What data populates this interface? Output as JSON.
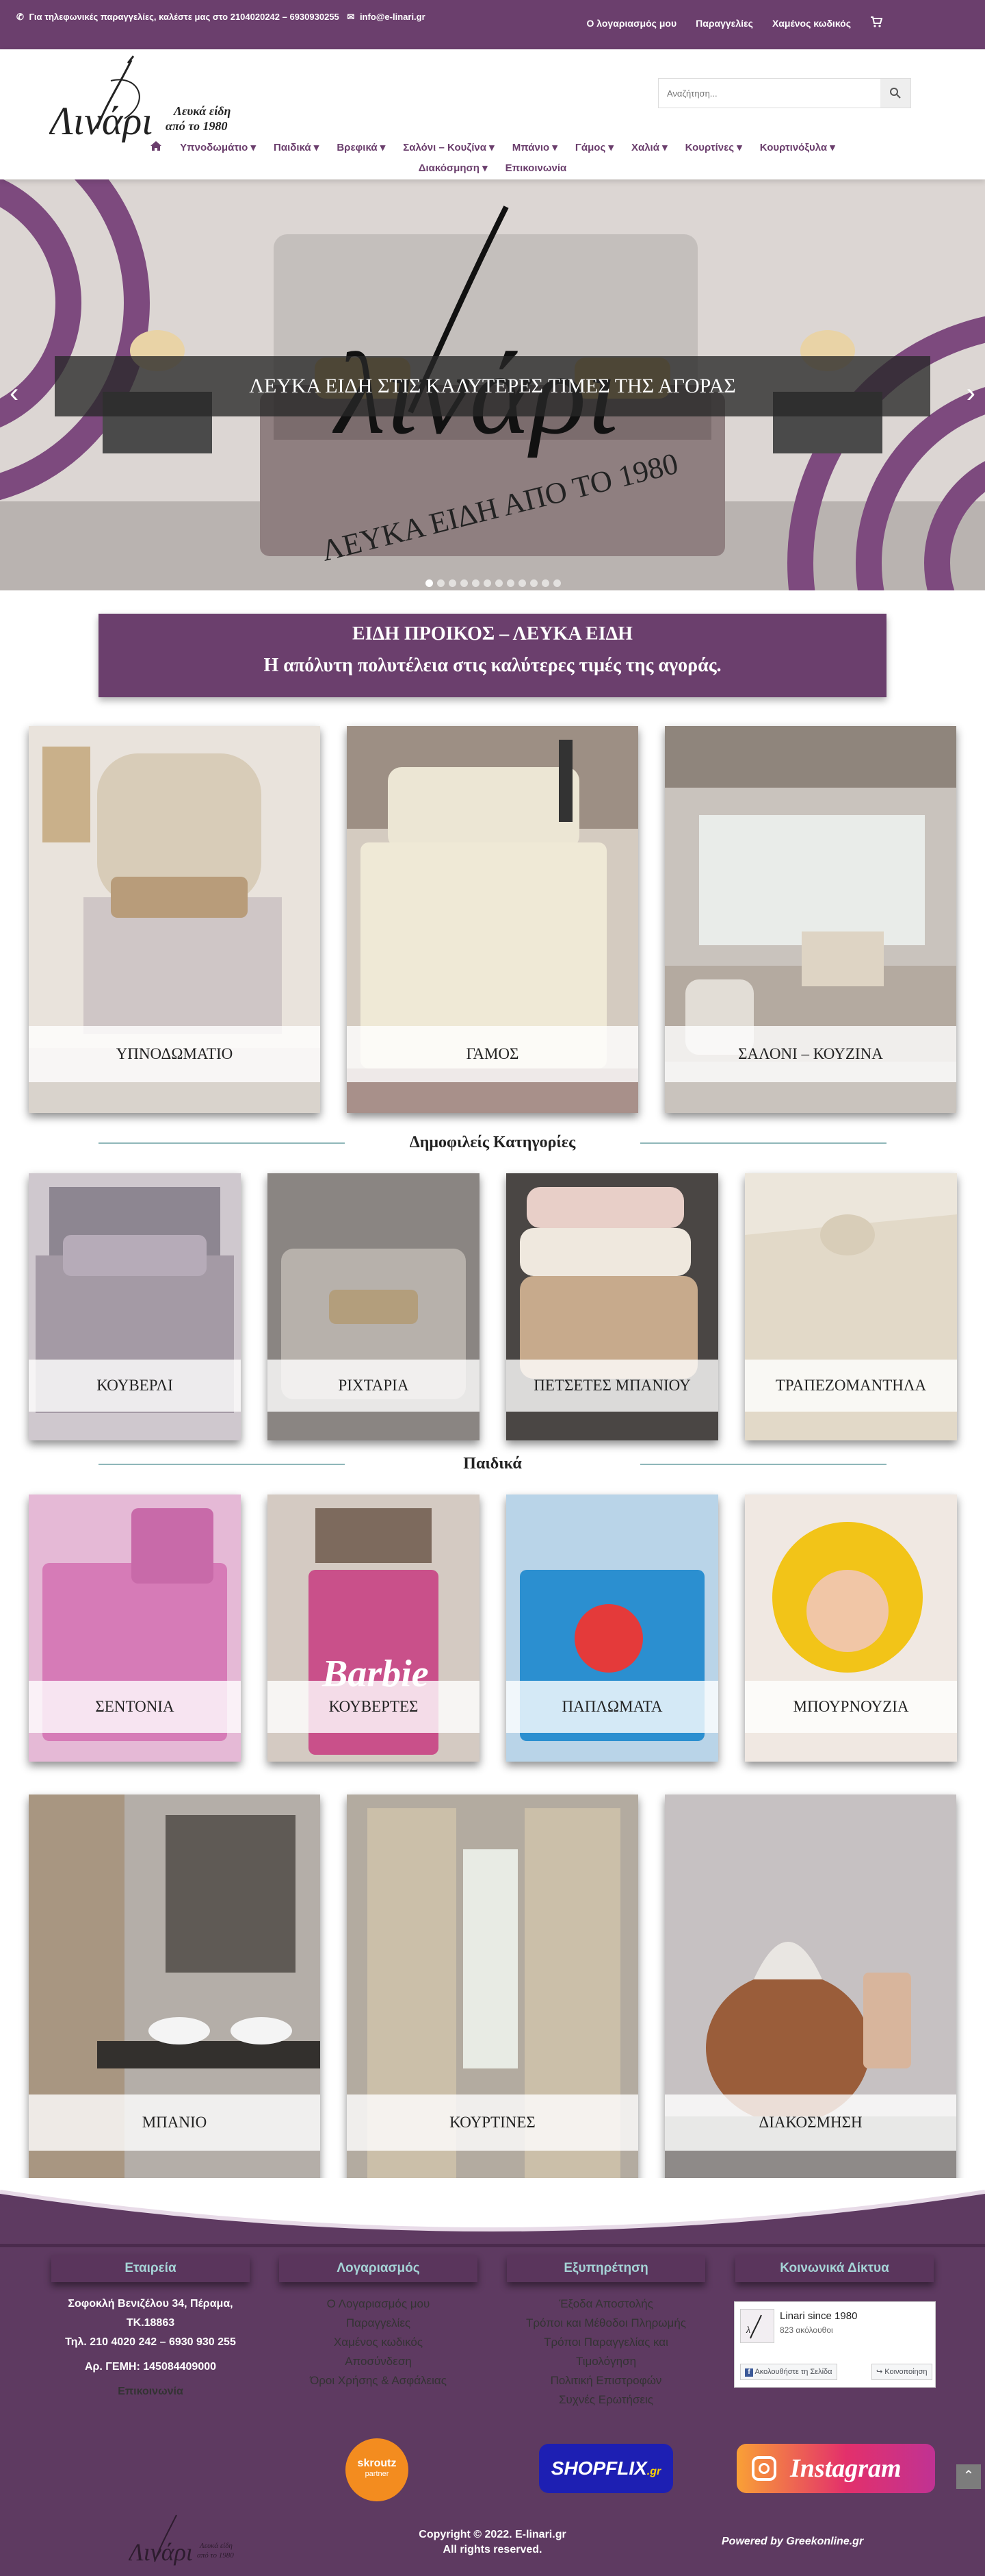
{
  "topbar": {
    "phone_text": "Για τηλεφωνικές παραγγελίες, καλέστε μας στο 2104020242 – 6930930255",
    "email": "info@e-linari.gr",
    "links": [
      "Ο λογαριασμός μου",
      "Παραγγελίες",
      "Χαμένος κωδικός"
    ]
  },
  "header": {
    "logo_name": "Λινάρι",
    "logo_tagline_1": "Λευκά είδη",
    "logo_tagline_2": "από το 1980",
    "search_placeholder": "Αναζήτηση..."
  },
  "nav": {
    "row1": [
      "Υπνοδωμάτιο",
      "Παιδικά",
      "Βρεφικά",
      "Σαλόνι – Κουζίνα",
      "Μπάνιο",
      "Γάμος",
      "Χαλιά",
      "Κουρτίνες",
      "Κουρτινόξυλα"
    ],
    "row2": [
      "Διακόσμηση",
      "Επικοινωνία"
    ]
  },
  "slider": {
    "caption": "ΛΕΥΚΑ ΕΙΔΗ ΣΤΙΣ ΚΑΛΥΤΕΡΕΣ ΤΙΜΕΣ ΤΗΣ ΑΓΟΡΑΣ",
    "logo_text": "λινάρι",
    "arc_text": "ΛΕΥΚΑ ΕΙΔΗ ΑΠΟ ΤΟ 1980",
    "slide_count": 12
  },
  "banner": {
    "line1": "ΕΙΔΗ ΠΡΟΙΚΟΣ – ΛΕΥΚΑ ΕΙΔΗ",
    "line2": "Η απόλυτη πολυτέλεια στις καλύτερες τιμές της αγοράς."
  },
  "main_categories": [
    "ΥΠΝΟΔΩΜΑΤΙΟ",
    "ΓΑΜΟΣ",
    "ΣΑΛΟΝΙ – ΚΟΥΖΙΝΑ"
  ],
  "popular": {
    "title": "Δημοφιλείς Κατηγορίες",
    "items": [
      "ΚΟΥΒΕΡΛΙ",
      "ΡΙΧΤΑΡΙΑ",
      "ΠΕΤΣΕΤΕΣ ΜΠΑΝΙΟΥ",
      "ΤΡΑΠΕΖΟΜΑΝΤΗΛΑ"
    ]
  },
  "kids": {
    "title": "Παιδικά",
    "items": [
      "ΣΕΝΤΟΝΙΑ",
      "ΚΟΥΒΕΡΤΕΣ",
      "ΠΑΠΛΩΜΑΤΑ",
      "ΜΠΟΥΡΝΟΥΖΙΑ"
    ],
    "barbie_text": "Barbie"
  },
  "bottom_categories": [
    "ΜΠΑΝΙΟ",
    "ΚΟΥΡΤΙΝΕΣ",
    "ΔΙΑΚΟΣΜΗΣΗ"
  ],
  "footer": {
    "company": {
      "title": "Εταιρεία",
      "lines": [
        "Σοφοκλή Βενιζέλου 34, Πέραμα,",
        "ΤΚ.18863",
        "Τηλ. 210 4020 242 – 6930 930 255",
        "Αρ. ΓΕΜΗ: 145084409000"
      ],
      "link": "Επικοινωνία"
    },
    "account": {
      "title": "Λογαριασμός",
      "links": [
        "Ο Λογαριασμός μου",
        "Παραγγελίες",
        "Χαμένος κωδικός",
        "Αποσύνδεση",
        "Όροι Χρήσης & Ασφάλειας"
      ]
    },
    "service": {
      "title": "Εξυπηρέτηση",
      "links": [
        "Έξοδα Αποστολής",
        "Τρόποι και Μέθοδοι Πληρωμής",
        "Τρόποι Παραγγελίας και",
        "Τιμολόγηση",
        "Πολιτική Επιστροφών",
        "Συχνές Ερωτήσεις"
      ]
    },
    "social": {
      "title": "Κοινωνικά Δίκτυα",
      "fb_page": "Linari since 1980",
      "fb_followers": "823 ακόλουθοι",
      "fb_follow": "Ακολουθήστε τη Σελίδα",
      "fb_share": "Κοινοποίηση"
    },
    "badges": {
      "skroutz": "skroutz",
      "skroutz_sub": "partner",
      "shopflix": "SHOPFLIX",
      "shopflix_suffix": ".gr",
      "instagram": "Instagram"
    },
    "logo_name": "Λινάρι",
    "logo_tagline_1": "Λευκά είδη",
    "logo_tagline_2": "από το 1980",
    "copyright_1": "Copyright © 2022. E-linari.gr",
    "copyright_2": "All rights reserved.",
    "powered": "Powered by Greekonline.gr"
  },
  "colors": {
    "brand_purple": "#6b3f6d",
    "footer_purple": "#5e3a61",
    "accent_teal": "#a5d3d6",
    "divider": "#8fb7b9"
  }
}
